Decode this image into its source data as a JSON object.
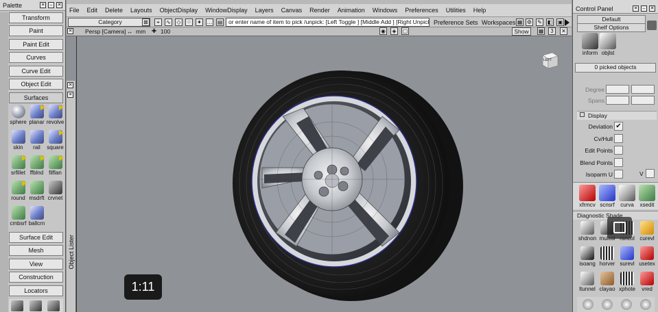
{
  "palette": {
    "title": "Palette",
    "buttons": [
      "Transform",
      "Paint",
      "Paint Edit",
      "Curves",
      "Curve Edit",
      "Object Edit",
      "Surfaces"
    ],
    "tools": [
      {
        "label": "sphere",
        "icon": "sphere-icon"
      },
      {
        "label": "planar",
        "icon": "planar-surface-icon"
      },
      {
        "label": "revolve",
        "icon": "revolve-icon"
      },
      {
        "label": "skin",
        "icon": "skin-icon"
      },
      {
        "label": "rail",
        "icon": "rail-icon"
      },
      {
        "label": "square",
        "icon": "square-icon"
      },
      {
        "label": "srfillet",
        "icon": "surface-fillet-icon"
      },
      {
        "label": "ffblnd",
        "icon": "freeform-blend-icon"
      },
      {
        "label": "filflan",
        "icon": "fillet-flange-icon"
      },
      {
        "label": "round",
        "icon": "round-icon"
      },
      {
        "label": "msdrft",
        "icon": "multi-surface-draft-icon"
      },
      {
        "label": "crvnet",
        "icon": "curve-network-icon"
      },
      {
        "label": "cmbsrf",
        "icon": "combine-surface-icon"
      },
      {
        "label": "ballcrn",
        "icon": "ball-corner-icon"
      }
    ],
    "lower_buttons": [
      "Surface Edit",
      "Mesh",
      "View",
      "Construction",
      "Locators"
    ],
    "object_lister": "Object Lister"
  },
  "menubar": {
    "items": [
      "File",
      "Edit",
      "Delete",
      "Layouts",
      "ObjectDisplay",
      "WindowDisplay",
      "Layers",
      "Canvas",
      "Render",
      "Animation",
      "Windows",
      "Preferences",
      "Utilities",
      "Help"
    ]
  },
  "toolbar": {
    "category_label": "Category",
    "pick_prompt": "or enter name of item to pick /unpick: [Left Toggle ] [Middle Add ] [Right Unpick ]",
    "preference_sets": "Preference Sets",
    "workspaces": "Workspaces"
  },
  "viewport": {
    "camera_label": "Persp [Camera]",
    "unit_label": "mm",
    "grid_value": "100",
    "show_label": "Show",
    "cube_label": "LEFT",
    "view_count": "3"
  },
  "video": {
    "timestamp": "1:11"
  },
  "control_panel": {
    "title": "Control Panel",
    "preset": "Default",
    "shelf": "Shelf Options",
    "info_tools": [
      {
        "label": "inform",
        "icon": "information-icon"
      },
      {
        "label": "objlst",
        "icon": "object-list-icon"
      }
    ],
    "picked": "0 picked objects",
    "degree_label": "Degree",
    "spans_label": "Spans",
    "display_section": "Display",
    "options": [
      {
        "label": "Deviation",
        "checked": true
      },
      {
        "label": "Cv/Hull",
        "checked": false
      },
      {
        "label": "Edit Points",
        "checked": false
      },
      {
        "label": "Blend Points",
        "checked": false
      },
      {
        "label": "Isoparm U",
        "checked": false
      }
    ],
    "isoparm_v": "V",
    "shelf_tools": [
      {
        "label": "xfrmcv",
        "icon": "transform-cv-icon"
      },
      {
        "label": "scnsrf",
        "icon": "scan-surface-icon"
      },
      {
        "label": "curva",
        "icon": "curvature-icon"
      },
      {
        "label": "xsedit",
        "icon": "xsection-edit-icon"
      }
    ],
    "diagnostic_title": "Diagnostic Shade",
    "diag_tools": [
      {
        "label": "shdnon",
        "icon": "shade-none-icon",
        "style": "ic-shade1"
      },
      {
        "label": "mulcol",
        "icon": "multi-color-icon",
        "style": "ic-shade7"
      },
      {
        "label": "rancol",
        "icon": "random-color-icon",
        "style": "ic-shade6"
      },
      {
        "label": "curevl",
        "icon": "curvature-eval-icon",
        "style": "ic-shade2"
      },
      {
        "label": "isoang",
        "icon": "isoangle-icon",
        "style": "ic-shade7"
      },
      {
        "label": "horver",
        "icon": "horizontal-vertical-icon",
        "style": "ic-shade6"
      },
      {
        "label": "surevl",
        "icon": "surface-eval-icon",
        "style": "ic-shade3"
      },
      {
        "label": "usetex",
        "icon": "use-texture-icon",
        "style": "ic-shade4"
      },
      {
        "label": "ltunnel",
        "icon": "light-tunnel-icon",
        "style": "ic-shade1"
      },
      {
        "label": "clayao",
        "icon": "clay-ao-icon",
        "style": "ic-shade5"
      },
      {
        "label": "xphote",
        "icon": "zebra-photo-icon",
        "style": "ic-shade6"
      },
      {
        "label": "vred",
        "icon": "vred-icon",
        "style": "ic-shade4"
      }
    ]
  }
}
